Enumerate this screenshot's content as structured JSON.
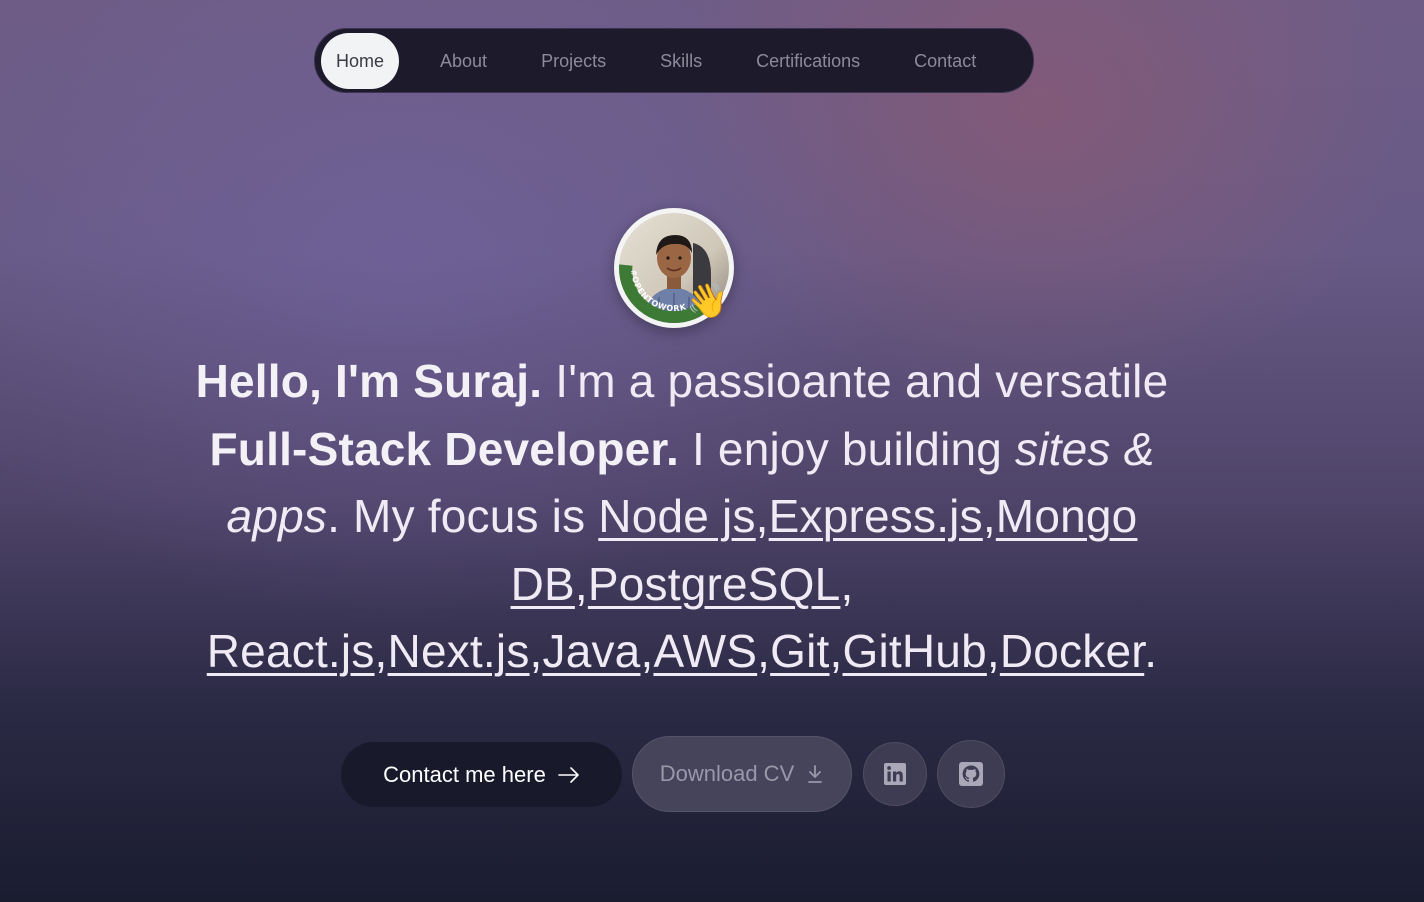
{
  "nav": {
    "items": [
      {
        "label": "Home",
        "active": true
      },
      {
        "label": "About"
      },
      {
        "label": "Projects"
      },
      {
        "label": "Skills"
      },
      {
        "label": "Certifications"
      },
      {
        "label": "Contact"
      }
    ]
  },
  "avatar": {
    "badge_text": "#OPENTOWORK",
    "emoji": "👋",
    "badge_color": "#3d7a35"
  },
  "hero": {
    "greeting": "Hello, I'm Suraj.",
    "text1": " I'm a passioante and versatile ",
    "role": "Full-Stack Developer.",
    "text2": " I enjoy building ",
    "sites_apps": "sites & apps",
    "text3": ". My focus is ",
    "skills": [
      "Node js",
      "Express.js",
      "Mongo DB",
      "PostgreSQL",
      "React.js",
      "Next.js",
      "Java",
      "AWS",
      "Git",
      "GitHub",
      "Docker"
    ],
    "separator": ",",
    "end": "."
  },
  "actions": {
    "contact_label": "Contact me here",
    "contact_icon": "arrow-right-icon",
    "cv_label": "Download CV",
    "cv_icon": "download-icon",
    "linkedin_icon": "linkedin-icon",
    "github_icon": "github-icon"
  },
  "colors": {
    "nav_bg": "#1c1a2b",
    "contact_bg": "#181a2b",
    "cv_bg": "#46445a",
    "text": "#efeaf3"
  }
}
